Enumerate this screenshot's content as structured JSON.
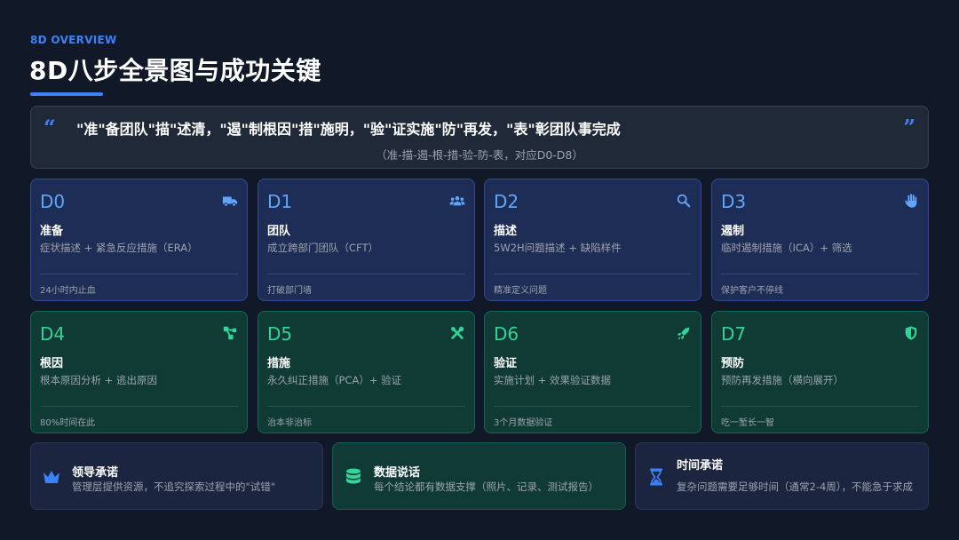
{
  "header": {
    "eyebrow": "8D OVERVIEW",
    "title": "8D八步全景图与成功关键"
  },
  "quote": {
    "main": "\"准\"备团队\"描\"述清，\"遏\"制根因\"措\"施明，\"验\"证实施\"防\"再发，\"表\"彰团队事完成",
    "sub": "（准-描-遏-根-措-验-防-表，对应D0-D8）"
  },
  "steps": [
    {
      "code": "D0",
      "name": "准备",
      "desc": "症状描述 + 紧急反应措施（ERA）",
      "note": "24小时内止血",
      "icon": "truck-icon"
    },
    {
      "code": "D1",
      "name": "团队",
      "desc": "成立跨部门团队（CFT）",
      "note": "打破部门墙",
      "icon": "users-icon"
    },
    {
      "code": "D2",
      "name": "描述",
      "desc": "5W2H问题描述 + 缺陷样件",
      "note": "精准定义问题",
      "icon": "search-icon"
    },
    {
      "code": "D3",
      "name": "遏制",
      "desc": "临时遏制措施（ICA）+ 筛选",
      "note": "保护客户不停线",
      "icon": "hand-icon"
    },
    {
      "code": "D4",
      "name": "根因",
      "desc": "根本原因分析 + 逃出原因",
      "note": "80%时间在此",
      "icon": "network-icon"
    },
    {
      "code": "D5",
      "name": "措施",
      "desc": "永久纠正措施（PCA）+ 验证",
      "note": "治本非治标",
      "icon": "tools-icon"
    },
    {
      "code": "D6",
      "name": "验证",
      "desc": "实施计划 + 效果验证数据",
      "note": "3个月数据验证",
      "icon": "rocket-icon"
    },
    {
      "code": "D7",
      "name": "预防",
      "desc": "预防再发措施（横向展开）",
      "note": "吃一堑长一智",
      "icon": "shield-icon"
    }
  ],
  "keys": [
    {
      "title": "领导承诺",
      "desc": "管理层提供资源，不追究探索过程中的\"试错\"",
      "icon": "crown-icon"
    },
    {
      "title": "数据说话",
      "desc": "每个结论都有数据支撑（照片、记录、测试报告）",
      "icon": "database-icon"
    },
    {
      "title": "时间承诺",
      "desc": "复杂问题需要足够时间（通常2-4周），不能急于求成",
      "icon": "hourglass-icon"
    }
  ],
  "colors": {
    "accent_blue": "#3b82f6",
    "accent_green": "#34d399",
    "background": "#111827"
  }
}
